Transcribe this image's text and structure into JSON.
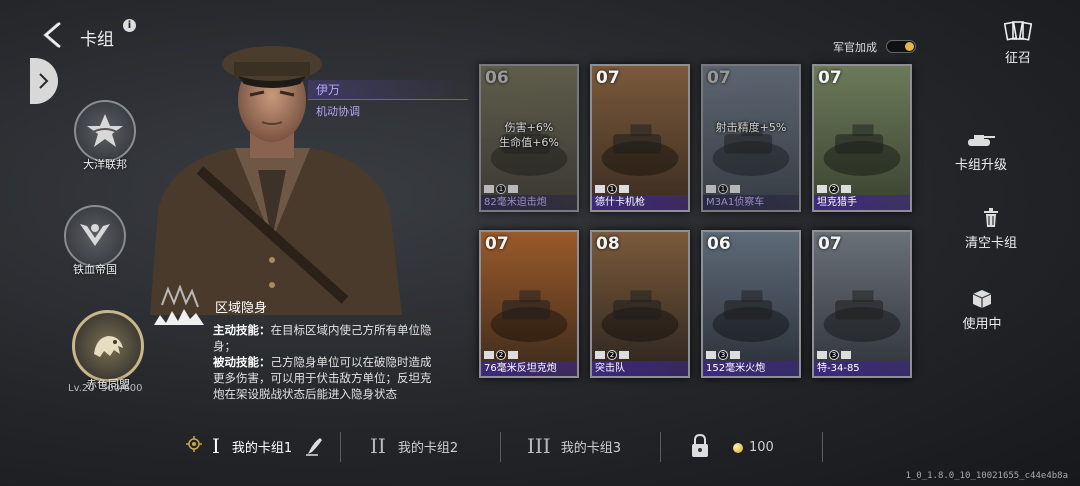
{
  "header": {
    "title": "卡组",
    "info_icon": "i"
  },
  "factions": [
    {
      "name": "大洋联邦",
      "icon": "star-eagle-icon"
    },
    {
      "name": "铁血帝国",
      "icon": "iron-eagle-icon"
    },
    {
      "name": "赤色同盟",
      "icon": "bear-icon",
      "level": "Lv.20",
      "progress": "500/600"
    }
  ],
  "officer": {
    "name": "伊万",
    "role": "机动协调"
  },
  "skill": {
    "title": "区域隐身",
    "active_label": "主动技能：",
    "active_text": "在目标区域内使己方所有单位隐身；",
    "passive_label": "被动技能：",
    "passive_text": "己方隐身单位可以在破隐时造成更多伤害，可以用于伏击敌方单位；反坦克炮在架设脱战状态后能进入隐身状态"
  },
  "toggle": {
    "label": "军官加成",
    "on": true
  },
  "recruit": {
    "label": "征召"
  },
  "actions": {
    "upgrade": "卡组升级",
    "clear": "清空卡组",
    "in_use": "使用中"
  },
  "cards": [
    {
      "cost": "06",
      "name": "82毫米迫击炮",
      "count": "1",
      "buffs": [
        "伤害+6%",
        "生命值+6%"
      ],
      "dim": true
    },
    {
      "cost": "07",
      "name": "德什卡机枪",
      "count": "1",
      "buffs": [],
      "dim": false
    },
    {
      "cost": "07",
      "name": "M3A1侦察车",
      "count": "1",
      "buffs": [
        "射击精度+5%"
      ],
      "dim": true
    },
    {
      "cost": "07",
      "name": "坦克猎手",
      "count": "2",
      "buffs": [],
      "dim": false
    },
    {
      "cost": "07",
      "name": "76毫米反坦克炮",
      "count": "2",
      "buffs": [],
      "dim": false
    },
    {
      "cost": "08",
      "name": "突击队",
      "count": "2",
      "buffs": [],
      "dim": false
    },
    {
      "cost": "06",
      "name": "152毫米火炮",
      "count": "3",
      "buffs": [],
      "dim": false
    },
    {
      "cost": "07",
      "name": "特-34-85",
      "count": "3",
      "buffs": [],
      "dim": false
    }
  ],
  "deck_tabs": [
    {
      "roman": "I",
      "label": "我的卡组1"
    },
    {
      "roman": "II",
      "label": "我的卡组2"
    },
    {
      "roman": "III",
      "label": "我的卡组3"
    }
  ],
  "currency": {
    "amount": "100"
  },
  "version": "1_0_1.8.0_10_10021655_c44e4b8a"
}
